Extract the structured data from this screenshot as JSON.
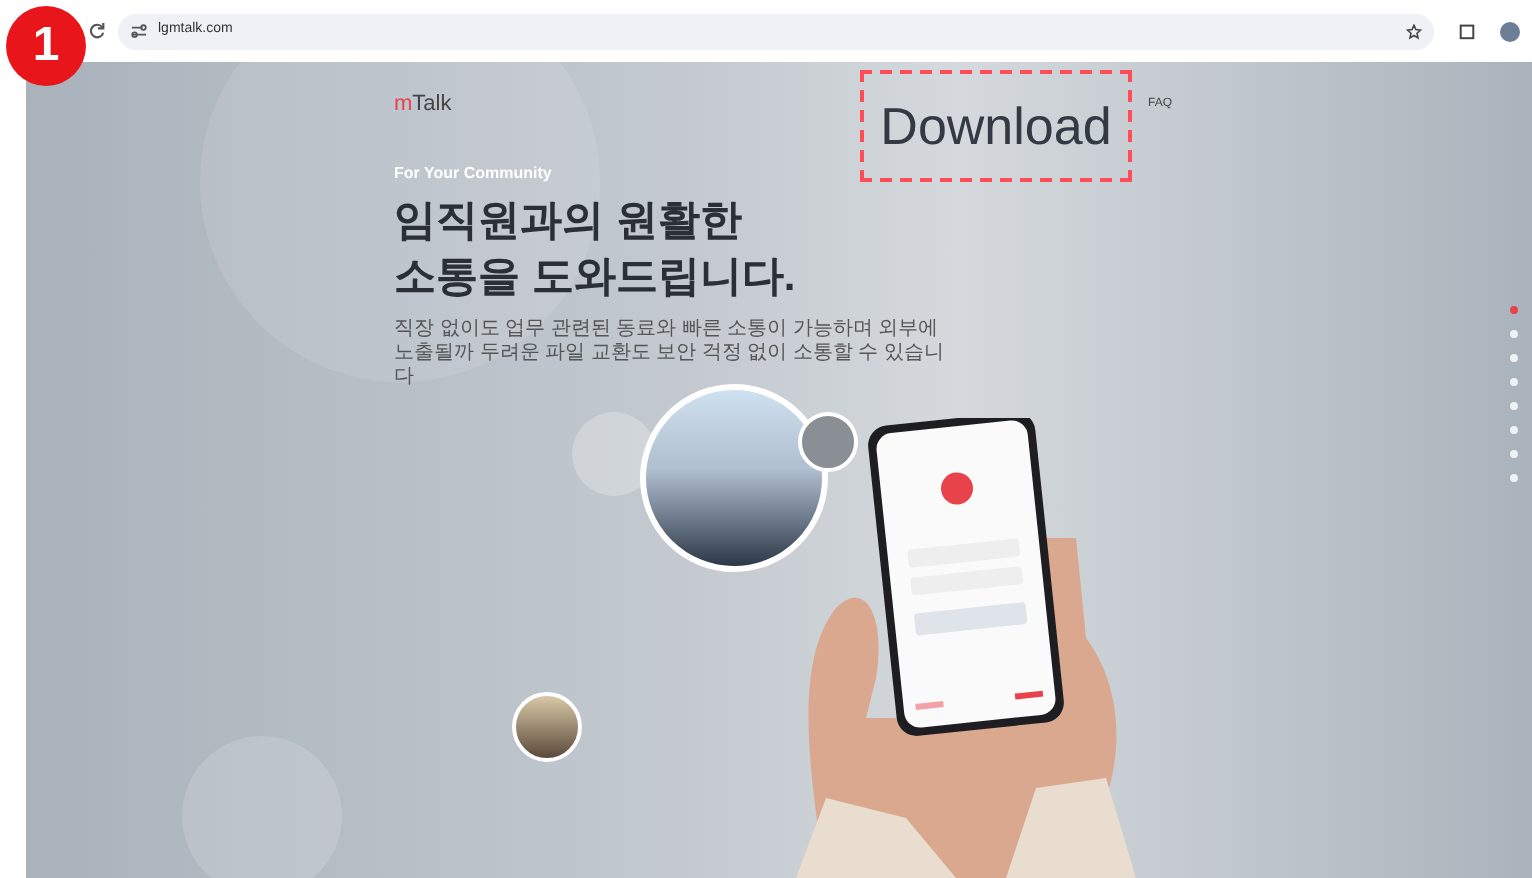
{
  "step_badge": "1",
  "browser": {
    "url": "lgmtalk.com"
  },
  "header": {
    "logo": {
      "accent": "m",
      "rest": "Talk"
    },
    "download": "Download",
    "faq": "FAQ"
  },
  "hero": {
    "eyebrow": "For Your Community",
    "headline": [
      "임직원과의 원활한",
      "소통을 도와드립니다."
    ],
    "description": "직장 없이도 업무 관련된 동료와 빠른 소통이 가능하며 외부에 노출될까 두려운 파일 교환도 보안 걱정 없이 소통할 수 있습니다"
  },
  "page_dots": [
    {
      "selected": true
    },
    {
      "selected": false
    },
    {
      "selected": false
    },
    {
      "selected": false
    },
    {
      "selected": false
    },
    {
      "selected": false
    },
    {
      "selected": false
    },
    {
      "selected": false
    }
  ]
}
